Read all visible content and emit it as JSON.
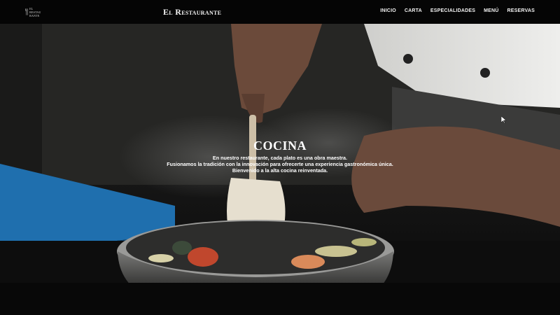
{
  "logo": {
    "text": "EL RESTAU RANTE"
  },
  "brand": {
    "title": "El Restaurante"
  },
  "nav": {
    "items": [
      {
        "label": "INICIO"
      },
      {
        "label": "CARTA"
      },
      {
        "label": "ESPECIALIDADES"
      },
      {
        "label": "MENÚ"
      },
      {
        "label": "RESERVAS"
      }
    ]
  },
  "hero": {
    "title": "COCINA",
    "lines": [
      "En nuestro restaurante, cada plato es una obra maestra.",
      "Fusionamos la tradición con la innovación para ofrecerte una experiencia gastronómica única.",
      "Bienvenido a la alta cocina reinventada."
    ]
  },
  "colors": {
    "navbar": "#050505",
    "text": "#ffffff",
    "board": "#1f6fae"
  }
}
